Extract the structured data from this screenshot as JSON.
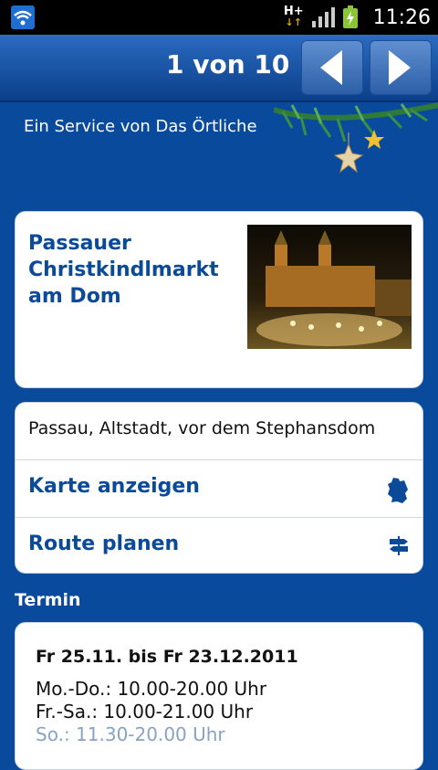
{
  "statusbar": {
    "network": "H+",
    "time": "11:26"
  },
  "header": {
    "pager": "1 von 10",
    "prev_icon": "chevron-left-icon",
    "next_icon": "chevron-right-icon"
  },
  "service_text": "Ein Service von Das Örtliche",
  "event": {
    "title": "Passauer Christkindlmarkt am Dom",
    "photo": "christmas-market-photo"
  },
  "location": {
    "address": "Passau, Altstadt, vor dem Stephansdom",
    "map_label": "Karte anzeigen",
    "map_icon": "germany-map-icon",
    "route_label": "Route planen",
    "route_icon": "signpost-icon"
  },
  "termin": {
    "section_label": "Termin",
    "date": "Fr 25.11. bis Fr 23.12.2011",
    "hours": [
      "Mo.-Do.: 10.00-20.00 Uhr",
      "Fr.-Sa.: 10.00-21.00 Uhr",
      "So.: 11.30-20.00 Uhr"
    ]
  },
  "colors": {
    "background": "#0a4a9c",
    "accent_text": "#0b4a99"
  }
}
